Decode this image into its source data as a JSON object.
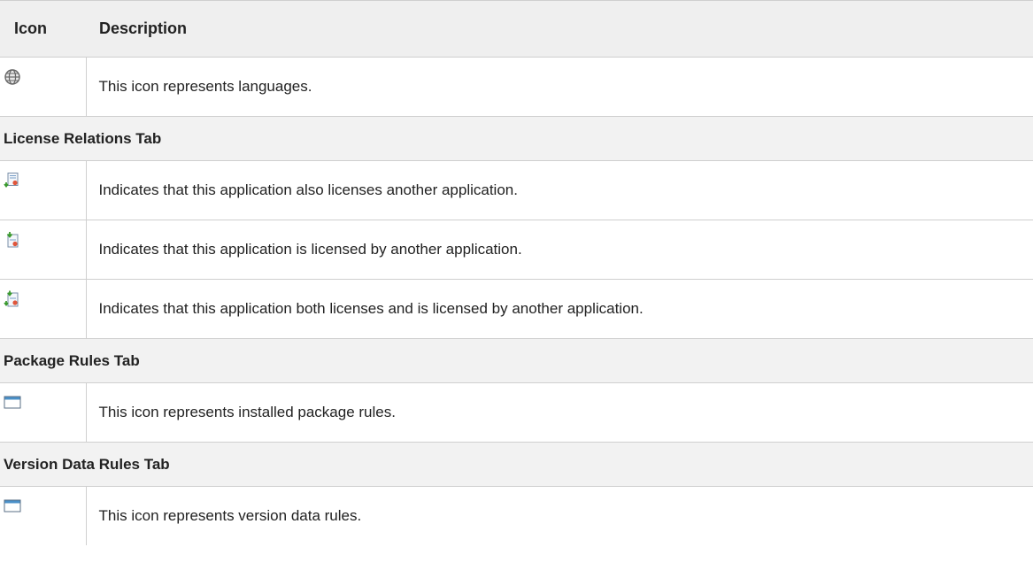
{
  "table": {
    "headers": {
      "icon": "Icon",
      "description": "Description"
    },
    "rows": [
      {
        "kind": "data",
        "icon": "globe-icon",
        "description": "This icon represents languages."
      },
      {
        "kind": "section",
        "title": "License Relations Tab"
      },
      {
        "kind": "data",
        "icon": "license-also-licenses-icon",
        "description": "Indicates that this application also licenses another application."
      },
      {
        "kind": "data",
        "icon": "license-licensed-by-icon",
        "description": "Indicates that this application is licensed by another application."
      },
      {
        "kind": "data",
        "icon": "license-both-icon",
        "description": "Indicates that this application both licenses and is licensed by another application."
      },
      {
        "kind": "section",
        "title": "Package Rules Tab"
      },
      {
        "kind": "data",
        "icon": "window-rule-icon",
        "description": "This icon represents installed package rules."
      },
      {
        "kind": "section",
        "title": "Version Data Rules Tab"
      },
      {
        "kind": "data",
        "icon": "window-rule-icon",
        "description": "This icon represents version data rules."
      }
    ]
  },
  "colors": {
    "header_bg": "#efefef",
    "section_bg": "#f2f2f2",
    "border": "#cfcfcf",
    "text": "#222222",
    "window_icon_blue": "#4a90c8"
  }
}
